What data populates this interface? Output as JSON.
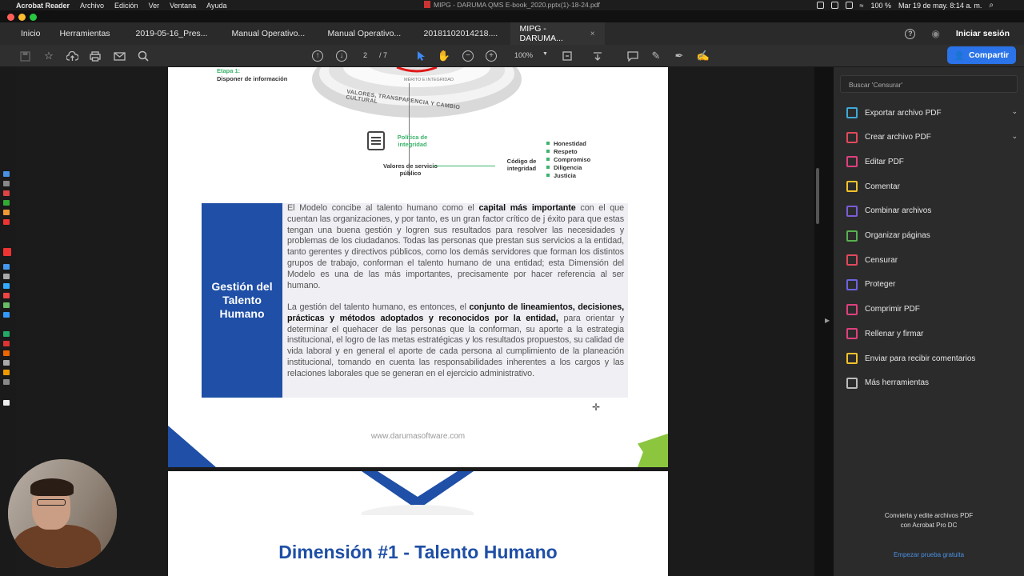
{
  "menubar": {
    "app": "Acrobat Reader",
    "items": [
      "Archivo",
      "Edición",
      "Ver",
      "Ventana",
      "Ayuda"
    ],
    "window_title": "MIPG - DARUMA QMS E-book_2020.pptx(1)-18-24.pdf",
    "battery": "100 %",
    "datetime": "Mar 19 de may.  8:14 a. m."
  },
  "tabs": {
    "home": "Inicio",
    "tools": "Herramientas",
    "docs": [
      "2019-05-16_Pres...",
      "Manual Operativo...",
      "Manual Operativo...",
      "20181102014218....",
      "MIPG - DARUMA..."
    ],
    "close": "×",
    "sign_in": "Iniciar sesión"
  },
  "toolbar": {
    "page_current": "2",
    "page_total": "/ 7",
    "zoom": "100%",
    "share_label": "Compartir"
  },
  "page1": {
    "etapa_title": "Etapa 1:",
    "etapa_sub": "Disponer de información",
    "ring_text": "VALORES, TRANSPARENCIA Y CAMBIO CULTURAL",
    "ring_inner": "MÉRITO E INTEGRIDAD",
    "politica": "Política de integridad",
    "valores_label": "Valores de servicio público",
    "codigo_label": "Código de integridad",
    "values": [
      "Honestidad",
      "Respeto",
      "Compromiso",
      "Diligencia",
      "Justicia"
    ],
    "box_title": "Gestión del Talento Humano",
    "para1_a": "El Modelo concibe al talento humano como el ",
    "para1_b": "capital más importante",
    "para1_c": " con el que cuentan las organizaciones, y por tanto, es un gran factor crítico de j éxito para que estas tengan una buena gestión y logren sus resultados para resolver las necesidades y problemas de los ciudadanos. Todas las personas que prestan sus servicios a la entidad, tanto gerentes y directivos públicos, como los demás servidores que forman los distintos grupos de trabajo, conforman el talento humano de una entidad; esta Dimensión del Modelo es una de las más importantes, precisamente por hacer referencia al ser humano.",
    "para2_a": "La gestión del talento humano, es entonces, el ",
    "para2_b": "conjunto de lineamientos, decisiones, prácticas y métodos adoptados y reconocidos por la entidad,",
    "para2_c": " para orientar y determinar el quehacer de las personas que la conforman, su aporte a la estrategia institucional, el logro de las metas estratégicas y los resultados propuestos, su calidad de vida laboral y en general el aporte de cada persona al cumplimiento de la planeación institucional, tomando en cuenta las responsabilidades inherentes a los cargos y las relaciones laborales que se generan en el ejercicio administrativo.",
    "url": "www.darumasoftware.com"
  },
  "page2": {
    "title": "Dimensión #1 - Talento Humano"
  },
  "right_panel": {
    "search_placeholder": "Buscar 'Censurar'",
    "tools": [
      {
        "label": "Exportar archivo PDF",
        "color": "#3fa8d8",
        "icon": "export-pdf-icon"
      },
      {
        "label": "Crear archivo PDF",
        "color": "#e2495c",
        "icon": "create-pdf-icon"
      },
      {
        "label": "Editar PDF",
        "color": "#e0407e",
        "icon": "edit-pdf-icon"
      },
      {
        "label": "Comentar",
        "color": "#f3c12b",
        "icon": "comment-icon"
      },
      {
        "label": "Combinar archivos",
        "color": "#7c5cd8",
        "icon": "combine-files-icon"
      },
      {
        "label": "Organizar páginas",
        "color": "#58b04f",
        "icon": "organize-pages-icon"
      },
      {
        "label": "Censurar",
        "color": "#e2495c",
        "icon": "redact-icon"
      },
      {
        "label": "Proteger",
        "color": "#6c63e0",
        "icon": "protect-icon"
      },
      {
        "label": "Comprimir PDF",
        "color": "#e0407e",
        "icon": "compress-pdf-icon"
      },
      {
        "label": "Rellenar y firmar",
        "color": "#e0407e",
        "icon": "fill-sign-icon"
      },
      {
        "label": "Enviar para recibir comentarios",
        "color": "#f3c12b",
        "icon": "send-comments-icon"
      },
      {
        "label": "Más herramientas",
        "color": "#bbbbbb",
        "icon": "more-tools-icon"
      }
    ],
    "promo_line1": "Convierta y edite archivos PDF",
    "promo_line2": "con Acrobat Pro DC",
    "trial": "Empezar prueba gratuita"
  }
}
